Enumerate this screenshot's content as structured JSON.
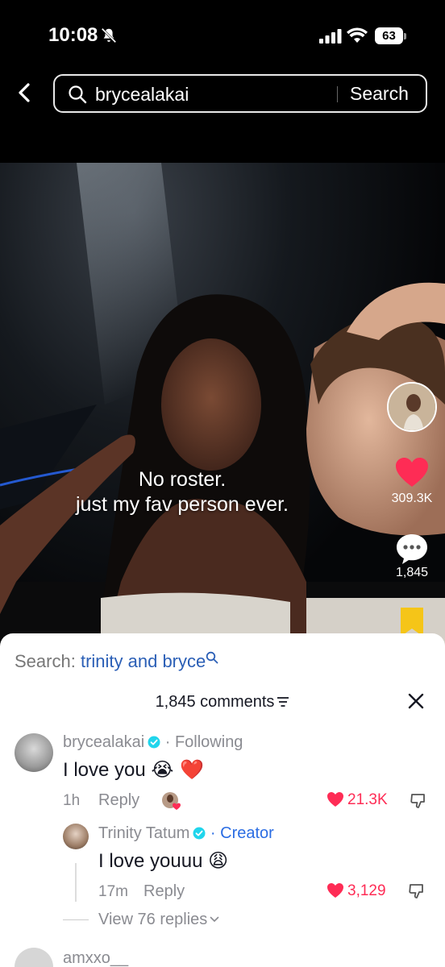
{
  "status_bar": {
    "time": "10:08",
    "battery": "63"
  },
  "search": {
    "query": "brycealakai",
    "button_label": "Search"
  },
  "video": {
    "caption_line1": "No roster.",
    "caption_line2": "just my fav person ever.",
    "like_count": "309.3K",
    "comment_count": "1,845"
  },
  "sheet": {
    "suggest_prefix": "Search:",
    "suggest_term": "trinity and bryce",
    "comments_title": "1,845 comments",
    "comments": [
      {
        "username": "brycealakai",
        "relation": "· Following",
        "text": "I love you",
        "emojis": "😭 ❤️",
        "time": "1h",
        "reply_label": "Reply",
        "likes": "21.3K"
      },
      {
        "username": "Trinity Tatum",
        "relation": "· Creator",
        "text": "I love youuu",
        "emojis": "😩",
        "time": "17m",
        "reply_label": "Reply",
        "likes": "3,129"
      },
      {
        "username": "amxxo__"
      }
    ],
    "view_replies": "View 76 replies"
  },
  "colors": {
    "like_red": "#fe2c55",
    "creator_blue": "#2b6de3",
    "bookmark_yellow": "#f5c518"
  }
}
